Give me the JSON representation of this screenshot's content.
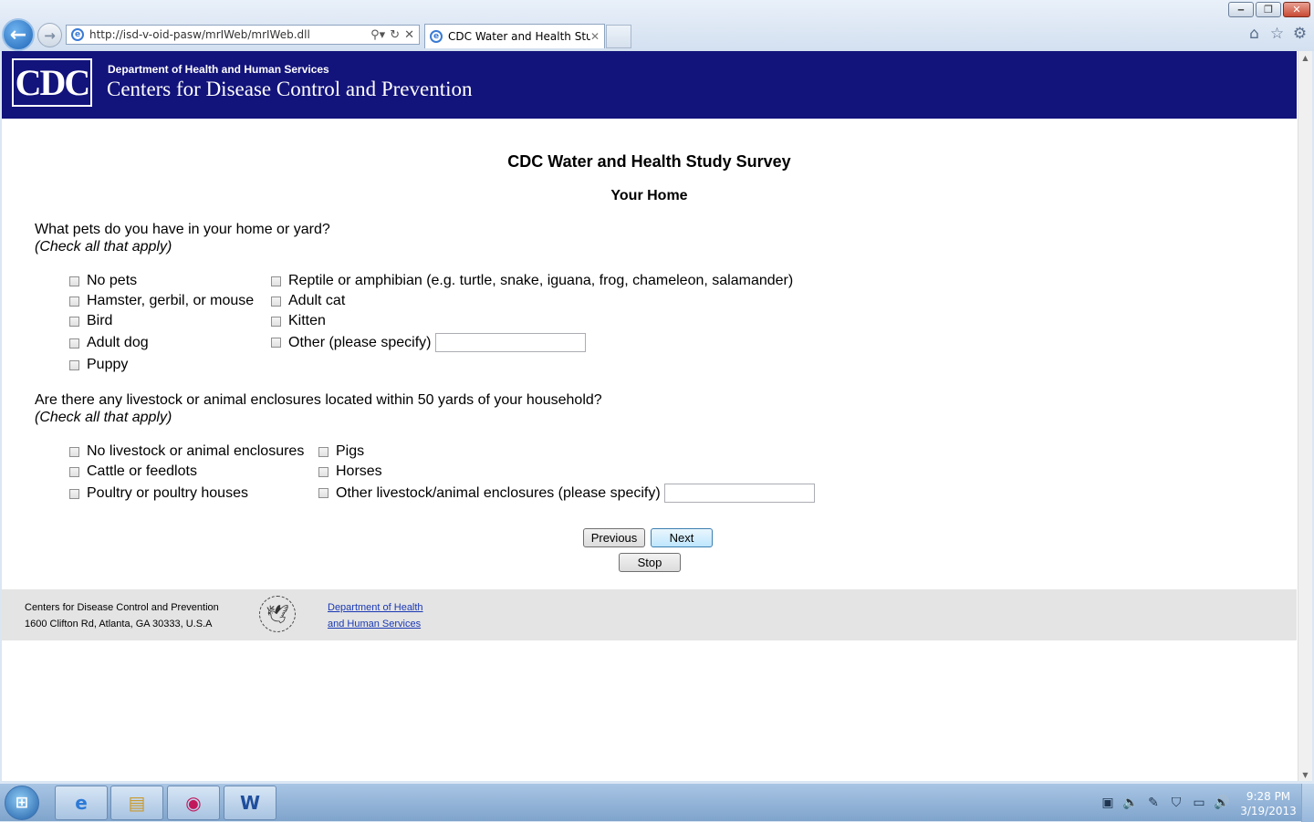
{
  "browser": {
    "url": "http://isd-v-oid-pasw/mrIWeb/mrIWeb.dll",
    "tab_title": "CDC Water and Health Study",
    "window_controls": {
      "minimize_icon": "minimize-icon",
      "restore_icon": "restore-icon",
      "close_icon": "close-icon"
    },
    "icons": [
      "back-arrow-icon",
      "forward-arrow-icon",
      "search-icon",
      "refresh-icon",
      "stop-icon",
      "home-icon",
      "favorites-star-icon",
      "gear-icon"
    ]
  },
  "banner": {
    "logo_text": "CDC",
    "department": "Department of Health and Human Services",
    "agency": "Centers for Disease Control and Prevention",
    "color": "#12137b"
  },
  "survey": {
    "title": "CDC Water and Health Study Survey",
    "section": "Your Home",
    "q1": {
      "text": "What pets do you have in your home or yard?",
      "hint": "(Check all that apply)",
      "options": [
        "No pets",
        "Hamster, gerbil, or mouse",
        "Bird",
        "Adult dog",
        "Puppy",
        "Reptile or amphibian (e.g. turtle, snake, iguana, frog, chameleon, salamander)",
        "Adult cat",
        "Kitten",
        "Other (please specify)"
      ],
      "other_value": ""
    },
    "q2": {
      "text": "Are there any livestock or animal enclosures located within 50 yards of your household?",
      "hint": "(Check all that apply)",
      "options": [
        "No livestock or animal enclosures",
        "Cattle or feedlots",
        "Poultry or poultry houses",
        "Pigs",
        "Horses",
        "Other livestock/animal enclosures (please specify)"
      ],
      "other_value": ""
    },
    "buttons": {
      "previous": "Previous",
      "next": "Next",
      "stop": "Stop"
    }
  },
  "footer": {
    "org_name": "Centers for Disease Control and Prevention",
    "address": "1600 Clifton Rd, Atlanta, GA 30333, U.S.A",
    "link_line1": "Department of Health",
    "link_line2": "and Human Services"
  },
  "taskbar": {
    "apps": [
      "internet-explorer-icon",
      "file-explorer-icon",
      "media-app-icon",
      "word-icon"
    ],
    "tray_icons": [
      "network-icon",
      "speaker-icon",
      "pen-icon",
      "security-shield-icon",
      "display-icon",
      "volume-icon"
    ],
    "time": "9:28 PM",
    "date": "3/19/2013"
  }
}
